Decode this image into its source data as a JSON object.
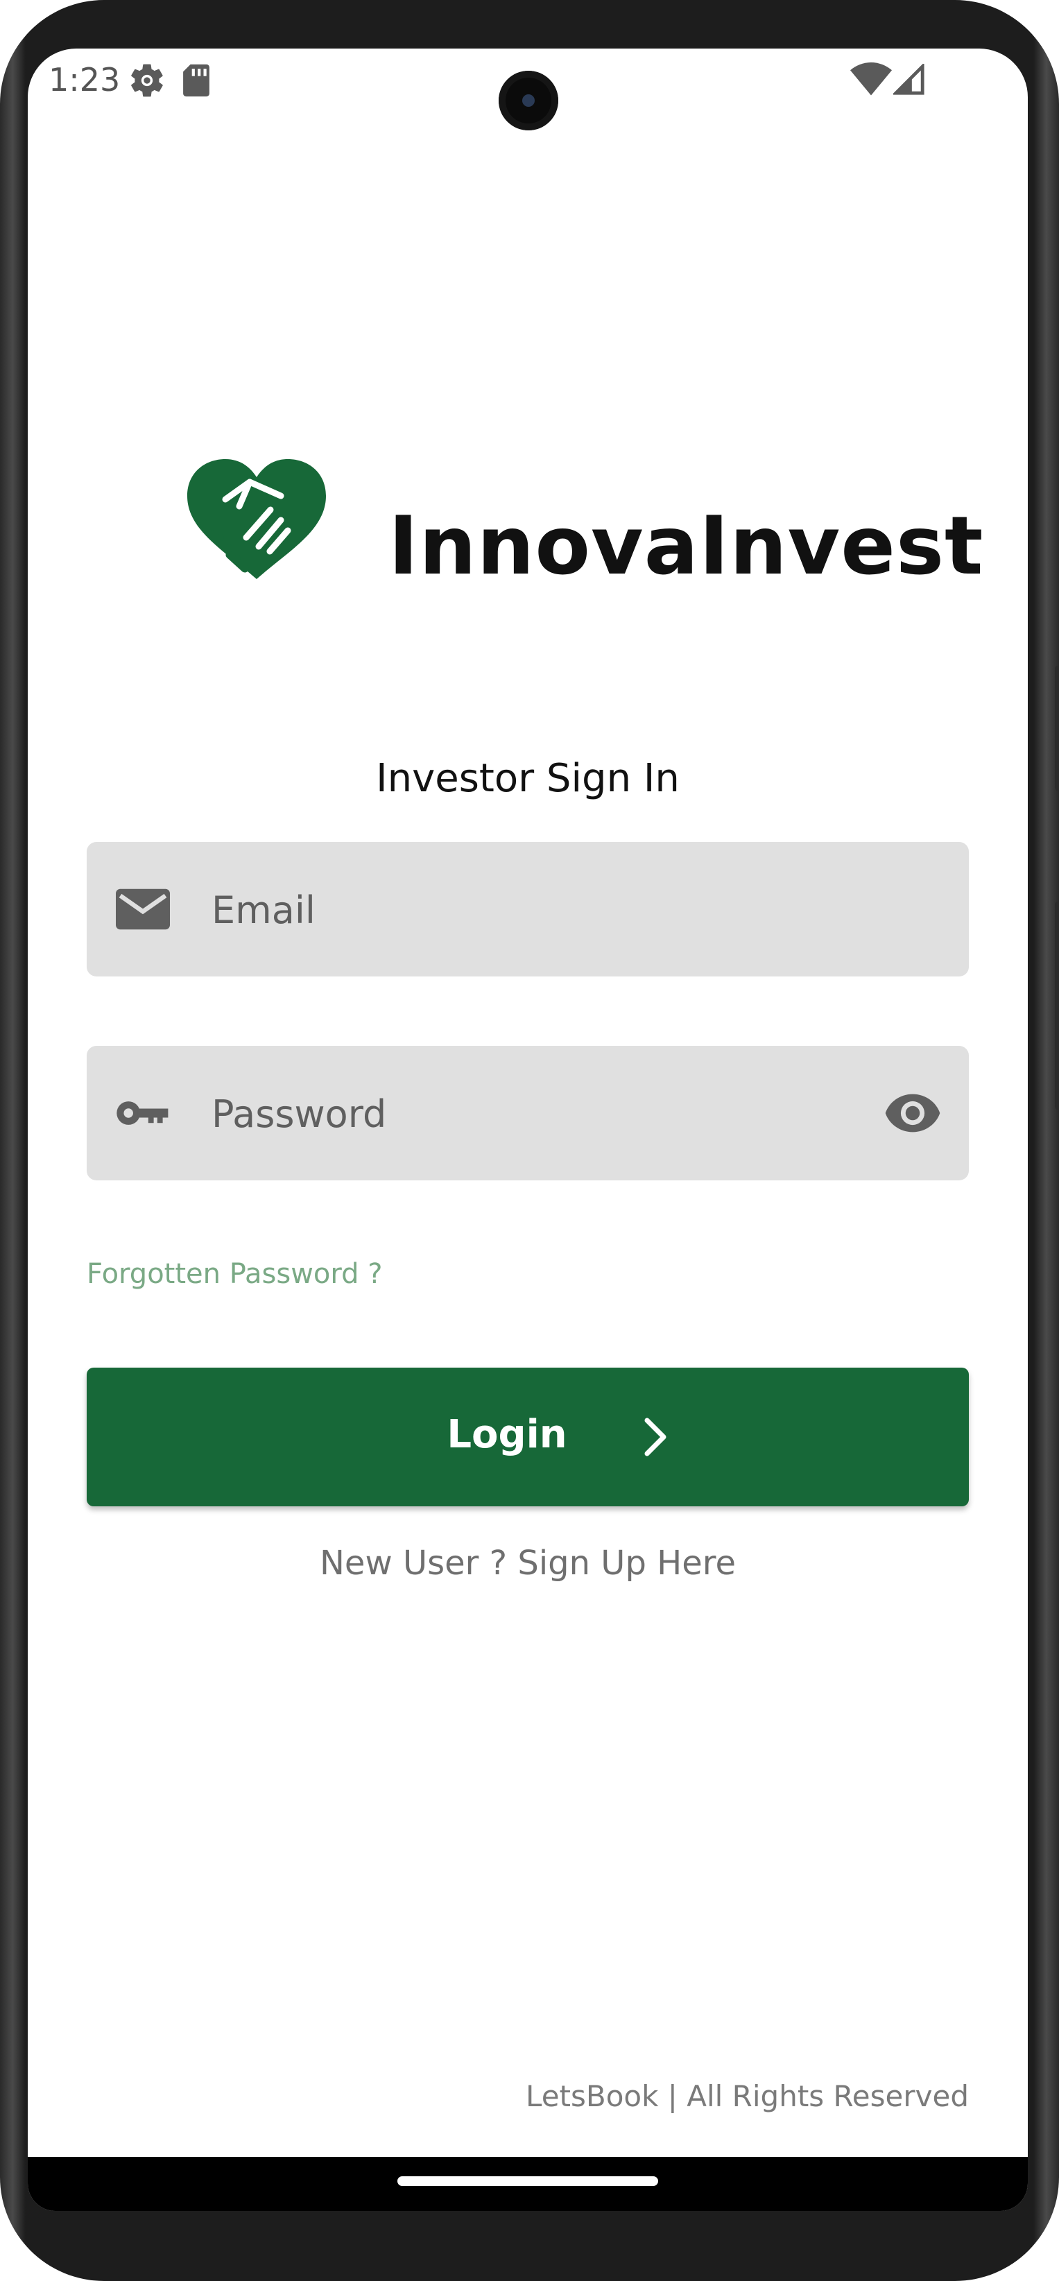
{
  "status_bar": {
    "time": "1:23",
    "icons": [
      "gear-icon",
      "sd-card-icon",
      "wifi-icon",
      "cell-signal-icon"
    ]
  },
  "brand": {
    "name": "InnovaInvest",
    "logo_icon": "heart-handshake-icon",
    "logo_color": "#176838"
  },
  "subtitle": "Investor Sign In",
  "email_field": {
    "placeholder": "Email",
    "value": "",
    "icon": "mail-icon"
  },
  "password_field": {
    "placeholder": "Password",
    "value": "",
    "icon": "key-icon",
    "toggle_icon": "eye-icon"
  },
  "forgot_password": "Forgotten Password ?",
  "login_button": {
    "label": "Login",
    "icon": "chevron-right-icon",
    "color": "#176838"
  },
  "signup_link": "New User ? Sign Up Here",
  "footer": "LetsBook | All Rights Reserved",
  "colors": {
    "accent": "#176838",
    "field_bg": "#e0e0e0",
    "link": "#7aa985"
  }
}
